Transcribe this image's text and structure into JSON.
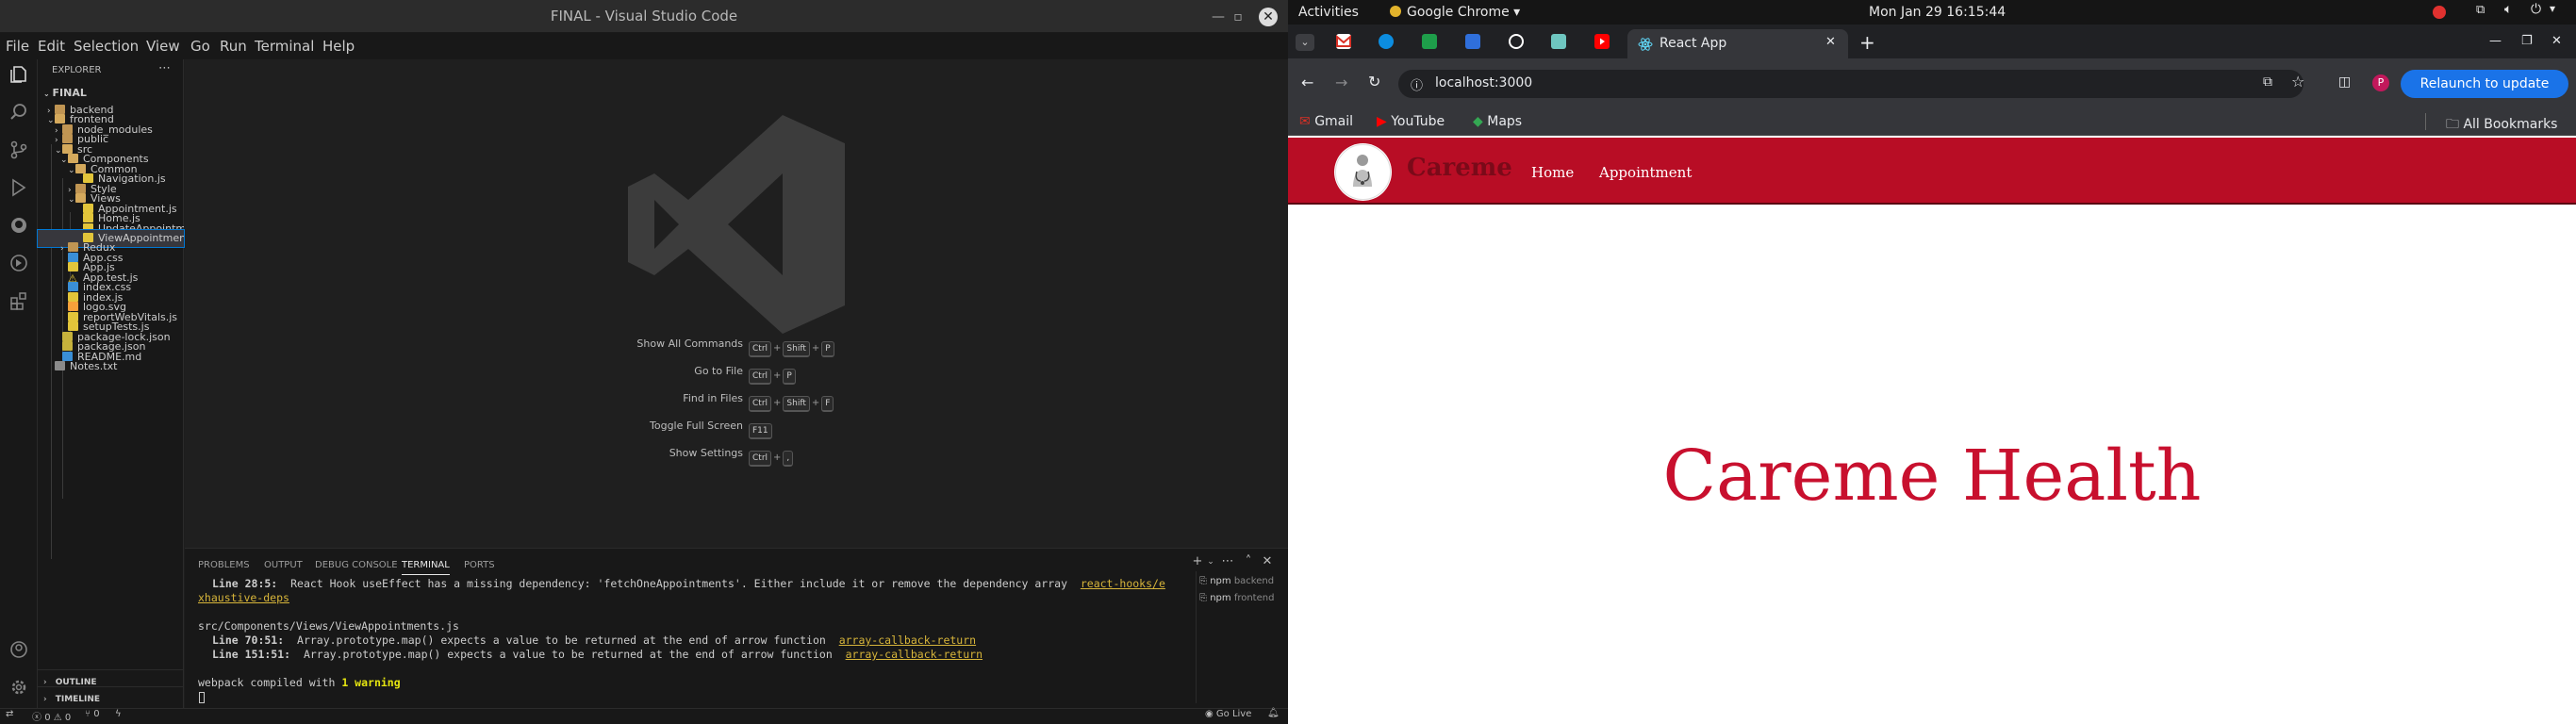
{
  "vscode": {
    "window_title": "FINAL - Visual Studio Code",
    "menus": [
      "File",
      "Edit",
      "Selection",
      "View",
      "Go",
      "Run",
      "Terminal",
      "Help"
    ],
    "explorer": {
      "title": "EXPLORER",
      "root": "FINAL",
      "items": [
        {
          "label": "backend",
          "type": "folder",
          "depth": 1
        },
        {
          "label": "frontend",
          "type": "folder-open",
          "depth": 1
        },
        {
          "label": "node_modules",
          "type": "folder",
          "depth": 2
        },
        {
          "label": "public",
          "type": "folder",
          "depth": 2
        },
        {
          "label": "src",
          "type": "folder-open",
          "depth": 2
        },
        {
          "label": "Components",
          "type": "folder-open",
          "depth": 3
        },
        {
          "label": "Common",
          "type": "folder-open",
          "depth": 4
        },
        {
          "label": "Navigation.js",
          "type": "js",
          "depth": 5
        },
        {
          "label": "Style",
          "type": "folder",
          "depth": 4
        },
        {
          "label": "Views",
          "type": "folder-open",
          "depth": 4
        },
        {
          "label": "Appointment.js",
          "type": "js",
          "depth": 5
        },
        {
          "label": "Home.js",
          "type": "js",
          "depth": 5
        },
        {
          "label": "UpdateAppointm...",
          "type": "js",
          "depth": 5
        },
        {
          "label": "ViewAppointmen...",
          "type": "js",
          "depth": 5,
          "selected": true
        },
        {
          "label": "Redux",
          "type": "folder",
          "depth": 3
        },
        {
          "label": "App.css",
          "type": "css",
          "depth": 3
        },
        {
          "label": "App.js",
          "type": "js",
          "depth": 3
        },
        {
          "label": "App.test.js",
          "type": "warn",
          "depth": 3
        },
        {
          "label": "index.css",
          "type": "css",
          "depth": 3
        },
        {
          "label": "index.js",
          "type": "js",
          "depth": 3
        },
        {
          "label": "logo.svg",
          "type": "svg",
          "depth": 3
        },
        {
          "label": "reportWebVitals.js",
          "type": "js",
          "depth": 3
        },
        {
          "label": "setupTests.js",
          "type": "js",
          "depth": 3
        },
        {
          "label": "package-lock.json",
          "type": "json",
          "depth": 2
        },
        {
          "label": "package.json",
          "type": "json",
          "depth": 2
        },
        {
          "label": "README.md",
          "type": "md",
          "depth": 2
        },
        {
          "label": "Notes.txt",
          "type": "txt",
          "depth": 1
        }
      ],
      "outline": "OUTLINE",
      "timeline": "TIMELINE"
    },
    "shortcuts": [
      {
        "label": "Show All Commands",
        "keys": [
          "Ctrl",
          "Shift",
          "P"
        ]
      },
      {
        "label": "Go to File",
        "keys": [
          "Ctrl",
          "P"
        ]
      },
      {
        "label": "Find in Files",
        "keys": [
          "Ctrl",
          "Shift",
          "F"
        ]
      },
      {
        "label": "Toggle Full Screen",
        "keys": [
          "F11"
        ]
      },
      {
        "label": "Show Settings",
        "keys": [
          "Ctrl",
          ","
        ]
      }
    ],
    "panel_tabs": [
      "PROBLEMS",
      "OUTPUT",
      "DEBUG CONSOLE",
      "TERMINAL",
      "PORTS"
    ],
    "terminal": {
      "l1_loc": "Line 28:5:",
      "l1_msg": "  React Hook useEffect has a missing dependency: 'fetchOneAppointments'. Either include it or remove the dependency array  ",
      "l1_link_a": "react-hooks/e",
      "l1_link_b": "xhaustive-deps",
      "file": "src/Components/Views/ViewAppointments.js",
      "l2_loc": "Line 70:51:",
      "l2_msg": "  Array.prototype.map() expects a value to be returned at the end of arrow function  ",
      "l2_link": "array-callback-return",
      "l3_loc": "Line 151:51:",
      "l3_msg": "  Array.prototype.map() expects a value to be returned at the end of arrow function  ",
      "l3_link": "array-callback-return",
      "compiled_prefix": "webpack compiled with ",
      "compiled_count": "1 warning",
      "sessions": [
        {
          "name": "npm",
          "sub": "backend"
        },
        {
          "name": "npm",
          "sub": "frontend"
        }
      ]
    },
    "status": {
      "errors": "0",
      "warnings": "0",
      "ports": "0",
      "golive": "Go Live"
    }
  },
  "desktop": {
    "activities": "Activities",
    "app_menu": "Google Chrome",
    "clock": "Mon Jan 29  16:15:44"
  },
  "chrome": {
    "active_tab_title": "React App",
    "url": "localhost:3000",
    "relaunch": "Relaunch to update",
    "profile_initial": "P",
    "bookmarks": [
      "Gmail",
      "YouTube",
      "Maps"
    ],
    "all_bookmarks": "All Bookmarks"
  },
  "app": {
    "brand": "Careme",
    "nav_links": [
      "Home",
      "Appointment"
    ],
    "hero": "Careme Health"
  }
}
